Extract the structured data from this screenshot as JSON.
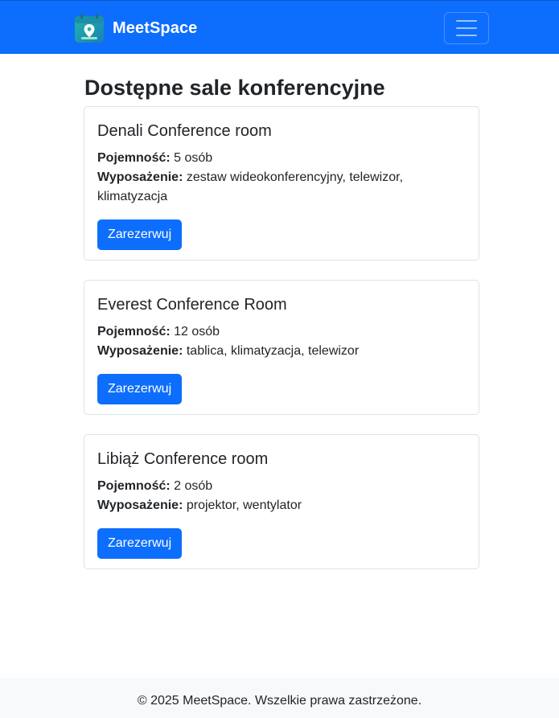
{
  "navbar": {
    "brand_name": "MeetSpace",
    "logo_icon": "calendar-location-icon",
    "menu_icon": "hamburger-menu-icon",
    "color": "#0d6efd"
  },
  "main": {
    "title": "Dostępne sale konferencyjne",
    "rooms": [
      {
        "name": "Denali Conference room",
        "capacity_label": "Pojemność:",
        "capacity_value": "5 osób",
        "equipment_label": "Wyposażenie:",
        "equipment_value": "zestaw wideokonferencyjny, telewizor, klimatyzacja",
        "button_label": "Zarezerwuj"
      },
      {
        "name": "Everest Conference Room",
        "capacity_label": "Pojemność:",
        "capacity_value": "12 osób",
        "equipment_label": "Wyposażenie:",
        "equipment_value": "tablica, klimatyzacja, telewizor",
        "button_label": "Zarezerwuj"
      },
      {
        "name": "Libiąż Conference room",
        "capacity_label": "Pojemność:",
        "capacity_value": "2 osób",
        "equipment_label": "Wyposażenie:",
        "equipment_value": "projektor, wentylator",
        "button_label": "Zarezerwuj"
      }
    ]
  },
  "footer": {
    "text": "© 2025 MeetSpace. Wszelkie prawa zastrzeżone."
  }
}
